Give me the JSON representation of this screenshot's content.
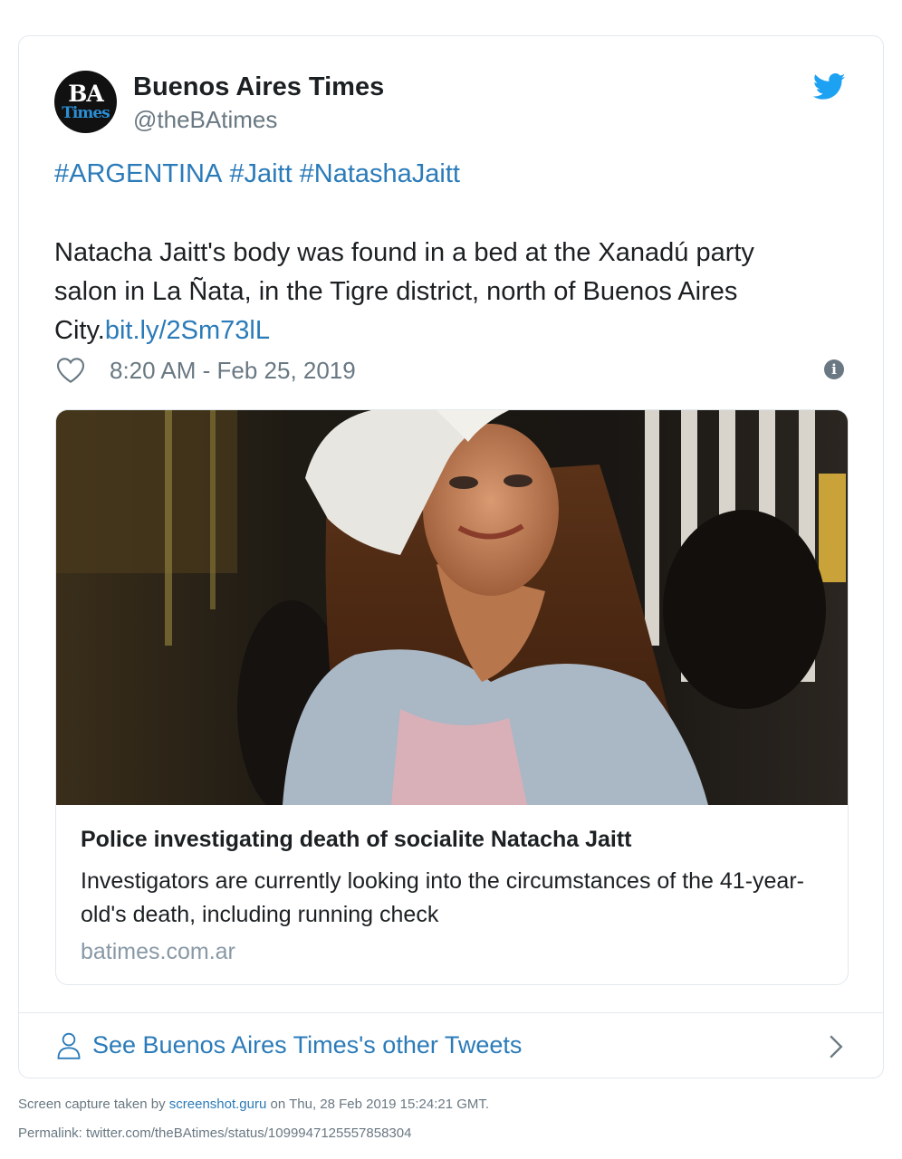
{
  "tweet": {
    "author": {
      "avatar_line1": "BA",
      "avatar_line2": "Times",
      "name": "Buenos Aires Times",
      "handle": "@theBAtimes"
    },
    "hashtags": [
      "#ARGENTINA",
      "#Jaitt",
      "#NatashaJaitt"
    ],
    "text": "Natacha Jaitt's body was found in a bed at the Xanadú party salon in La Ñata, in the Tigre district, north of Buenos Aires City.",
    "link": "bit.ly/2Sm73lL",
    "timestamp": "8:20 AM - Feb 25, 2019",
    "info_glyph": "i",
    "icons": {
      "brand": "twitter-bird-icon",
      "like": "heart-icon",
      "info": "info-icon",
      "profile": "person-icon",
      "next": "chevron-right-icon"
    },
    "colors": {
      "link": "#2b7bb9",
      "muted": "#697882",
      "twitter_blue": "#1da1f2"
    }
  },
  "preview": {
    "image_alt": "Woman in white knit beanie with long brown hair",
    "title": "Police investigating death of socialite Natacha Jaitt",
    "description": "Investigators are currently looking into the circumstances of the 41-year-old's death, including running check",
    "domain": "batimes.com.ar"
  },
  "footer": {
    "see_more": "See Buenos Aires Times's other Tweets"
  },
  "capture": {
    "prefix": "Screen capture taken by ",
    "service": "screenshot.guru",
    "suffix": " on Thu, 28 Feb 2019 15:24:21 GMT.",
    "permalink_label": "Permalink: ",
    "permalink": "twitter.com/theBAtimes/status/1099947125557858304"
  }
}
